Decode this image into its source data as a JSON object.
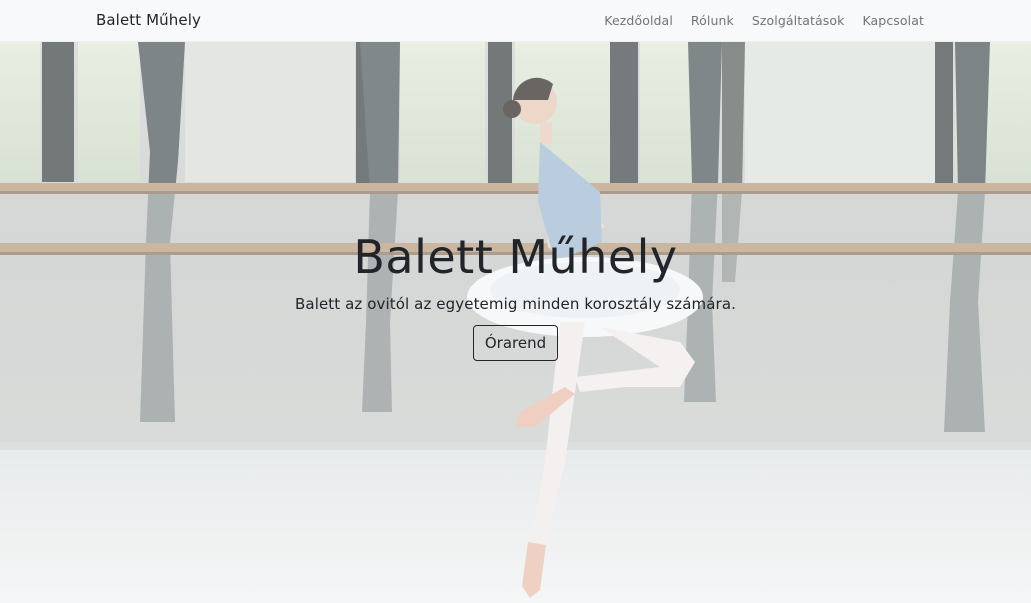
{
  "navbar": {
    "brand": "Balett Műhely",
    "links": [
      {
        "label": "Kezdőoldal"
      },
      {
        "label": "Rólunk"
      },
      {
        "label": "Szolgáltatások"
      },
      {
        "label": "Kapcsolat"
      }
    ]
  },
  "hero": {
    "title": "Balett Műhely",
    "subtitle": "Balett az ovitól az egyetemig minden korosztály számára.",
    "button_label": "Órarend"
  },
  "colors": {
    "text": "#212529",
    "nav_link": "#6c757d",
    "navbar_bg": "#f8f9fa"
  }
}
